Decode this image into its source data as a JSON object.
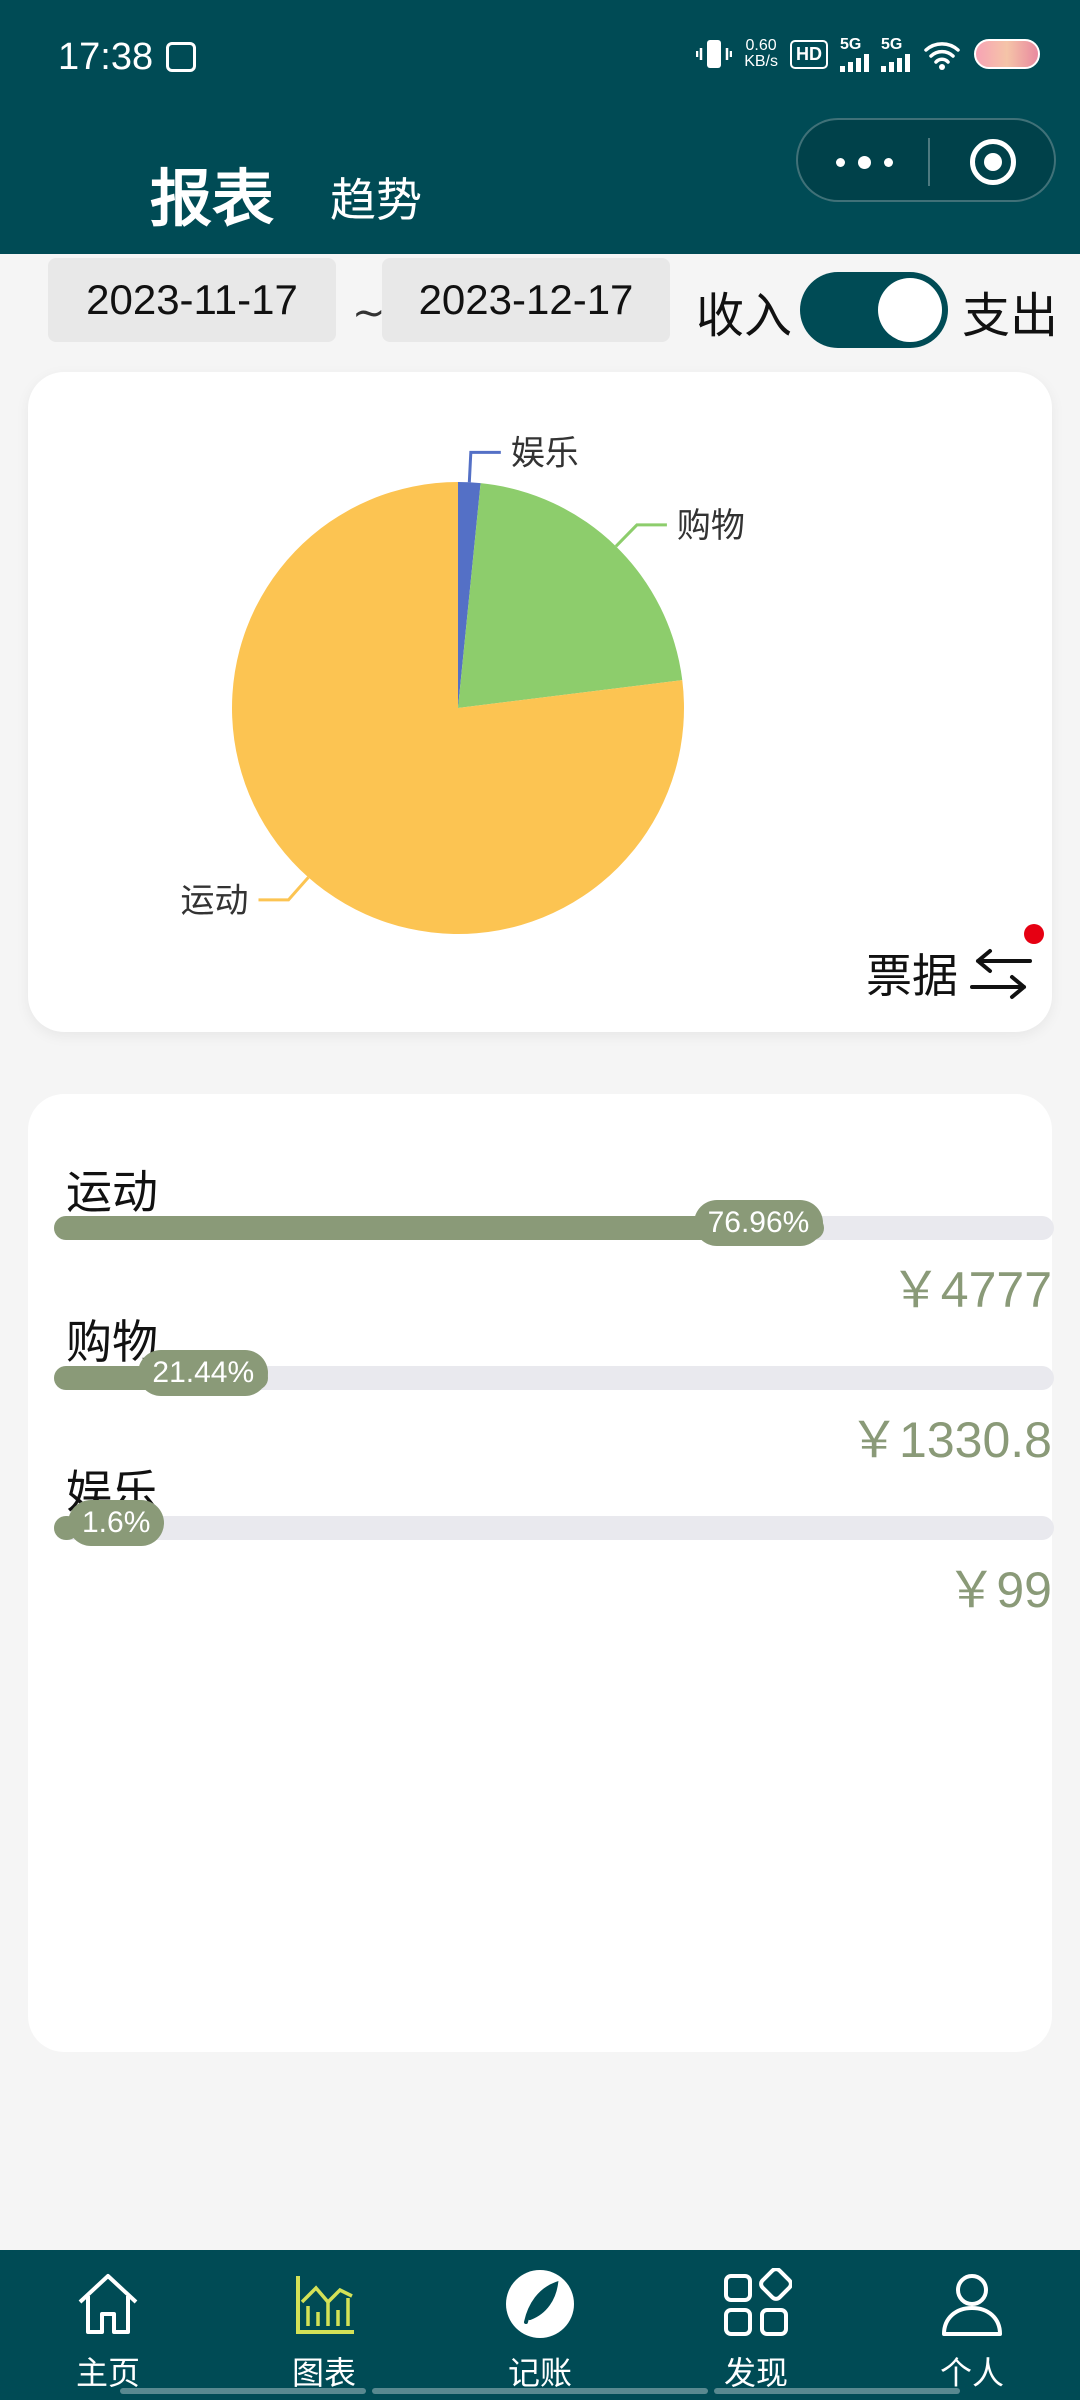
{
  "status_bar": {
    "time": "17:38",
    "net_speed": "0.60",
    "net_unit": "KB/s",
    "hd": "HD",
    "sim1": "5G",
    "sim2": "5G"
  },
  "header": {
    "tab_active": "报表",
    "tab_other": "趋势"
  },
  "filter": {
    "start_date": "2023-11-17",
    "separator": "~",
    "end_date": "2023-12-17",
    "income_label": "收入",
    "expense_label": "支出",
    "toggle_state": "expense"
  },
  "chart_data": {
    "type": "pie",
    "series": [
      {
        "label": "运动",
        "value": 4777,
        "color": "#fcc452"
      },
      {
        "label": "购物",
        "value": 1330.8,
        "color": "#8dcd6c"
      },
      {
        "label": "娱乐",
        "value": 99,
        "color": "#5470c6"
      }
    ]
  },
  "receipt_label": "票据",
  "categories": [
    {
      "name": "运动",
      "percent_label": "76.96%",
      "percent": 76.96,
      "amount": "￥4777"
    },
    {
      "name": "购物",
      "percent_label": "21.44%",
      "percent": 21.44,
      "amount": "￥1330.8"
    },
    {
      "name": "娱乐",
      "percent_label": "1.6%",
      "percent": 1.6,
      "amount": "￥99"
    }
  ],
  "nav": [
    {
      "label": "主页",
      "icon": "home-icon"
    },
    {
      "label": "图表",
      "icon": "chart-icon"
    },
    {
      "label": "记账",
      "icon": "feather-icon"
    },
    {
      "label": "发现",
      "icon": "grid-icon"
    },
    {
      "label": "个人",
      "icon": "user-icon"
    }
  ]
}
